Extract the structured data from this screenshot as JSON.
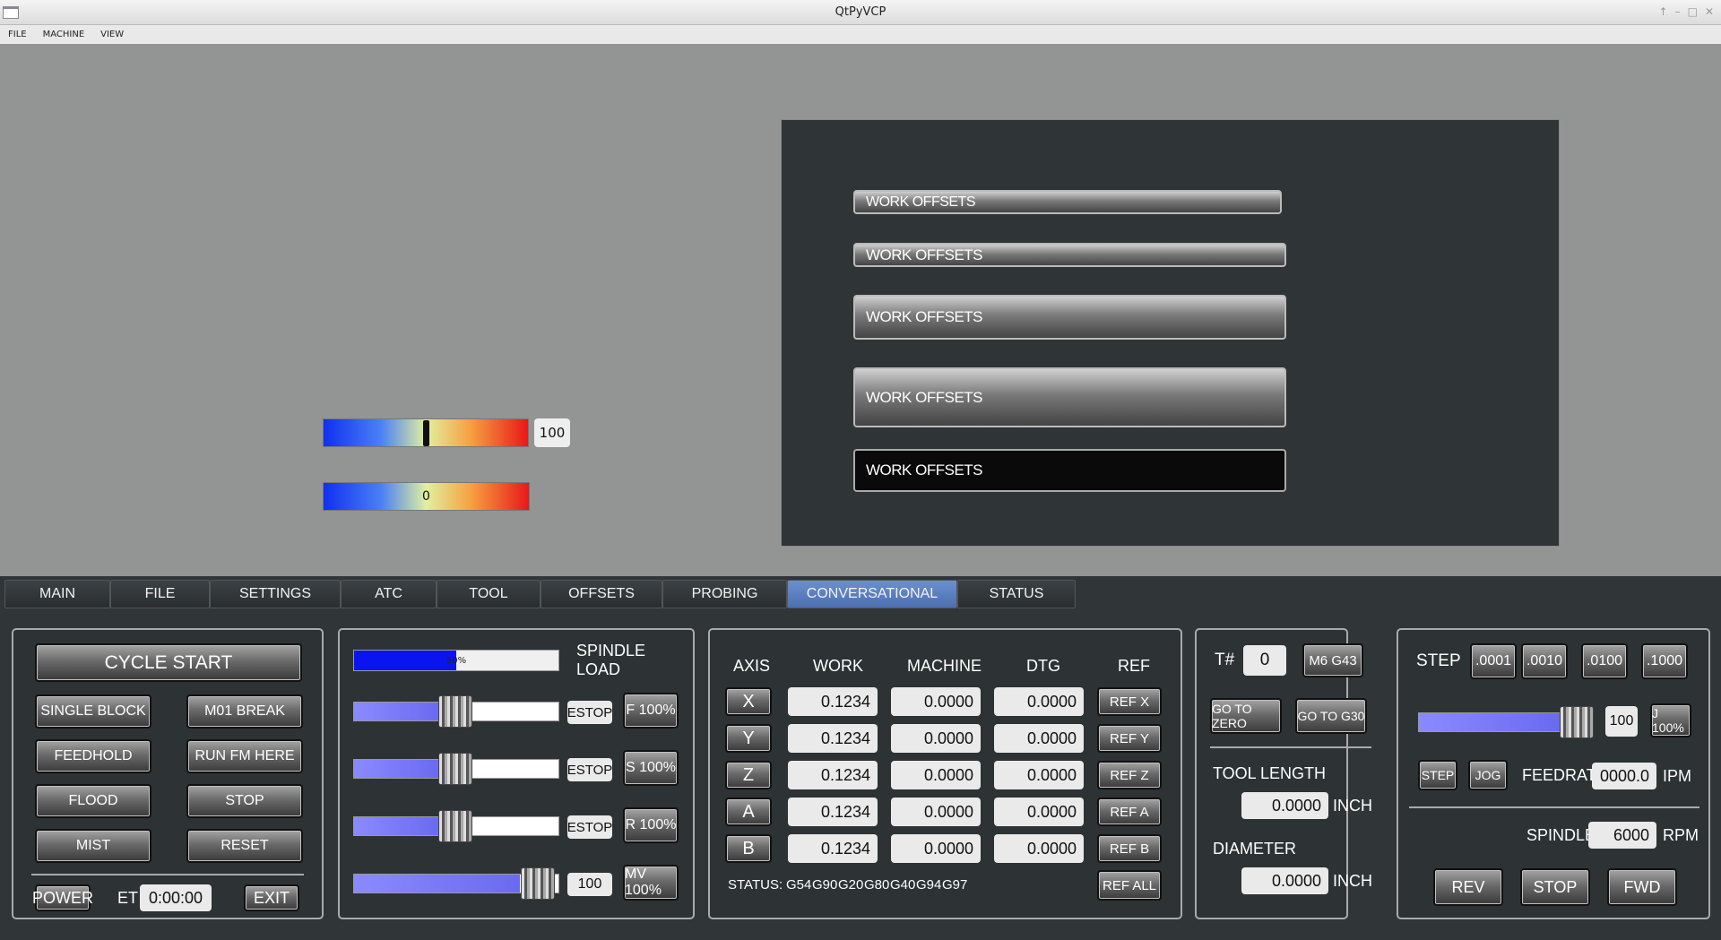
{
  "window": {
    "title": "QtPyVCP"
  },
  "menu": [
    "FILE",
    "MACHINE",
    "VIEW"
  ],
  "gradient_bars": {
    "bar1_value": "100",
    "bar1_marker_fraction": 0.5,
    "bar2_value": "0"
  },
  "work_offsets": [
    "WORK OFFSETS",
    "WORK OFFSETS",
    "WORK OFFSETS",
    "WORK OFFSETS",
    "WORK OFFSETS"
  ],
  "tabs": [
    "MAIN",
    "FILE",
    "SETTINGS",
    "ATC",
    "TOOL",
    "OFFSETS",
    "PROBING",
    "CONVERSATIONAL",
    "STATUS"
  ],
  "active_tab": "CONVERSATIONAL",
  "program": {
    "cycle_start": "CYCLE START",
    "single_block": "SINGLE BLOCK",
    "m01_break": "M01 BREAK",
    "feedhold": "FEEDHOLD",
    "run_fm_here": "RUN FM HERE",
    "flood": "FLOOD",
    "stop": "STOP",
    "mist": "MIST",
    "reset": "RESET",
    "power": "POWER",
    "et_label": "ET",
    "et_value": "0:00:00",
    "exit": "EXIT"
  },
  "overrides": {
    "spindle_load_label": "SPINDLE LOAD",
    "spindle_load_text": "50%",
    "spindle_load_fraction": 0.5,
    "estop": "ESTOP",
    "feed": "F 100%",
    "spindle": "S 100%",
    "rapid": "R 100%",
    "max_vel_value": "100",
    "max_vel": "MV 100%"
  },
  "dro": {
    "headers": [
      "AXIS",
      "WORK",
      "MACHINE",
      "DTG",
      "REF"
    ],
    "rows": [
      {
        "axis": "X",
        "work": "0.1234",
        "machine": "0.0000",
        "dtg": "0.0000",
        "ref": "REF X"
      },
      {
        "axis": "Y",
        "work": "0.1234",
        "machine": "0.0000",
        "dtg": "0.0000",
        "ref": "REF Y"
      },
      {
        "axis": "Z",
        "work": "0.1234",
        "machine": "0.0000",
        "dtg": "0.0000",
        "ref": "REF Z"
      },
      {
        "axis": "A",
        "work": "0.1234",
        "machine": "0.0000",
        "dtg": "0.0000",
        "ref": "REF A"
      },
      {
        "axis": "B",
        "work": "0.1234",
        "machine": "0.0000",
        "dtg": "0.0000",
        "ref": "REF B"
      }
    ],
    "status_label": "STATUS:",
    "gcodes": [
      "G54",
      "G90",
      "G20",
      "G80",
      "G40",
      "G94",
      "G97"
    ],
    "ref_all": "REF ALL"
  },
  "tool": {
    "tnum_label": "T#",
    "tnum_value": "0",
    "m6g43": "M6 G43",
    "go_to_zero": "GO TO ZERO",
    "go_to_g30": "GO TO G30",
    "tool_length_label": "TOOL LENGTH",
    "tool_length_value": "0.0000",
    "diameter_label": "DIAMETER",
    "diameter_value": "0.0000",
    "unit": "INCH"
  },
  "jog": {
    "step_label": "STEP",
    "steps": [
      ".0001",
      ".0010",
      ".0100",
      ".1000"
    ],
    "jog_value": "100",
    "jog_pct": "J 100%",
    "step_btn": "STEP",
    "jog_btn": "JOG",
    "feedrate_label": "FEEDRATE",
    "feedrate_value": "0000.0",
    "feedrate_unit": "IPM",
    "spindle_label": "SPINDLE",
    "spindle_value": "6000",
    "spindle_unit": "RPM",
    "rev": "REV",
    "stop": "STOP",
    "fwd": "FWD"
  }
}
